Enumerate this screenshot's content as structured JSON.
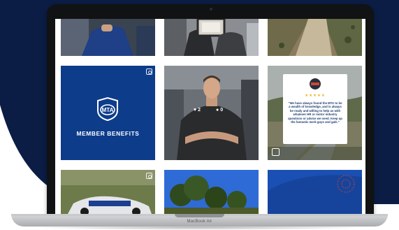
{
  "laptop": {
    "brand_label": "MacBook Air"
  },
  "grid": {
    "member_benefits_label": "MEMBER BENEFITS",
    "post_stats": {
      "likes": "2",
      "comments": "0"
    },
    "testimonial": {
      "stars": "★★★★★",
      "quote": "\"We have always found the MTA to be a wealth of knowledge, and is always be ready and willing to help us with whatever HR or motor industry questions or advice we need. Keep up the fantastic work guys and gals.\""
    }
  },
  "colors": {
    "navy": "#0b1d45",
    "brand_blue": "#0d3c8b",
    "quote_text": "#1c3b6e",
    "star": "#f0b323"
  }
}
